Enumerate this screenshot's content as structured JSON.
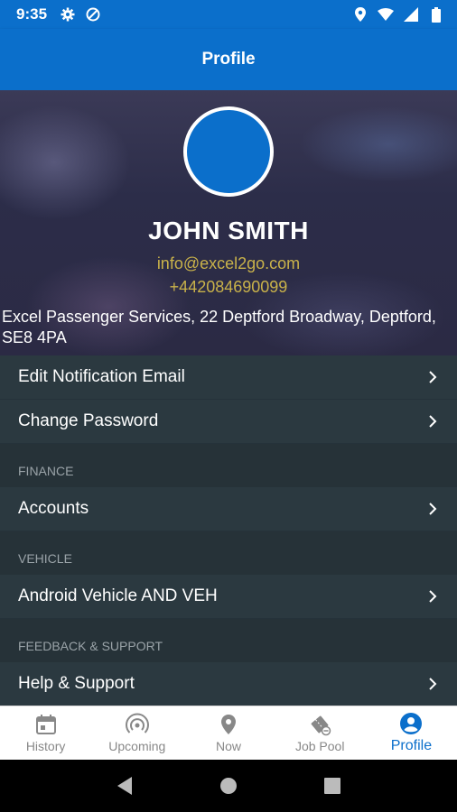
{
  "status_bar": {
    "time": "9:35"
  },
  "app_bar": {
    "title": "Profile"
  },
  "profile": {
    "name": "JOHN SMITH",
    "email": "info@excel2go.com",
    "phone": "+442084690099",
    "address": "Excel Passenger Services, 22 Deptford Broadway, Deptford, SE8 4PA"
  },
  "menu": {
    "edit_notification_email": "Edit Notification Email",
    "change_password": "Change Password",
    "finance_header": "FINANCE",
    "accounts": "Accounts",
    "vehicle_header": "VEHICLE",
    "vehicle_name": "Android Vehicle AND VEH",
    "feedback_header": "FEEDBACK & SUPPORT",
    "help_support": "Help & Support"
  },
  "bottom_nav": {
    "items": [
      {
        "label": "History",
        "icon": "calendar-icon"
      },
      {
        "label": "Upcoming",
        "icon": "broadcast-icon"
      },
      {
        "label": "Now",
        "icon": "location-pin-icon"
      },
      {
        "label": "Job Pool",
        "icon": "tickets-icon"
      },
      {
        "label": "Profile",
        "icon": "account-circle-icon"
      }
    ],
    "active": "Profile"
  },
  "colors": {
    "primary": "#0b6fcb",
    "accent_text": "#c9b24a",
    "menu_bg": "#2b3940"
  }
}
